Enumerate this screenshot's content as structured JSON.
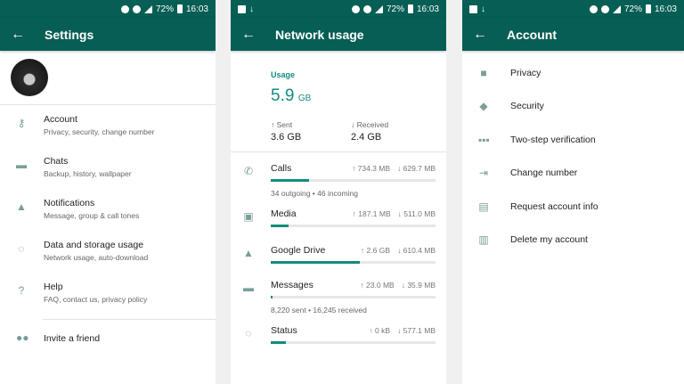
{
  "status": {
    "battery": "72%",
    "time": "16:03"
  },
  "settings": {
    "title": "Settings",
    "items": [
      {
        "title": "Account",
        "subtitle": "Privacy, security, change number"
      },
      {
        "title": "Chats",
        "subtitle": "Backup, history, wallpaper"
      },
      {
        "title": "Notifications",
        "subtitle": "Message, group & call tones"
      },
      {
        "title": "Data and storage usage",
        "subtitle": "Network usage, auto-download"
      },
      {
        "title": "Help",
        "subtitle": "FAQ, contact us, privacy policy"
      }
    ],
    "invite": "Invite a friend"
  },
  "network": {
    "title": "Network usage",
    "usage_label": "Usage",
    "total_value": "5.9",
    "total_unit": "GB",
    "sent_label": "↑ Sent",
    "sent_value": "3.6 GB",
    "received_label": "↓ Received",
    "received_value": "2.4 GB",
    "items": [
      {
        "name": "Calls",
        "sent": "↑ 734.3 MB",
        "received": "↓ 629.7 MB",
        "sub": "34 outgoing • 46 incoming",
        "fraction": 0.23
      },
      {
        "name": "Media",
        "sent": "↑ 187.1 MB",
        "received": "↓ 511.0 MB",
        "sub": "",
        "fraction": 0.11
      },
      {
        "name": "Google Drive",
        "sent": "↑ 2.6 GB",
        "received": "↓ 610.4 MB",
        "sub": "",
        "fraction": 0.54
      },
      {
        "name": "Messages",
        "sent": "↑ 23.0 MB",
        "received": "↓ 35.9 MB",
        "sub": "8,220 sent • 16,245 received",
        "fraction": 0.01
      },
      {
        "name": "Status",
        "sent": "↑ 0 kB",
        "received": "↓ 577.1 MB",
        "sub": "",
        "fraction": 0.09
      }
    ]
  },
  "account": {
    "title": "Account",
    "items": [
      "Privacy",
      "Security",
      "Two-step verification",
      "Change number",
      "Request account info",
      "Delete my account"
    ]
  }
}
